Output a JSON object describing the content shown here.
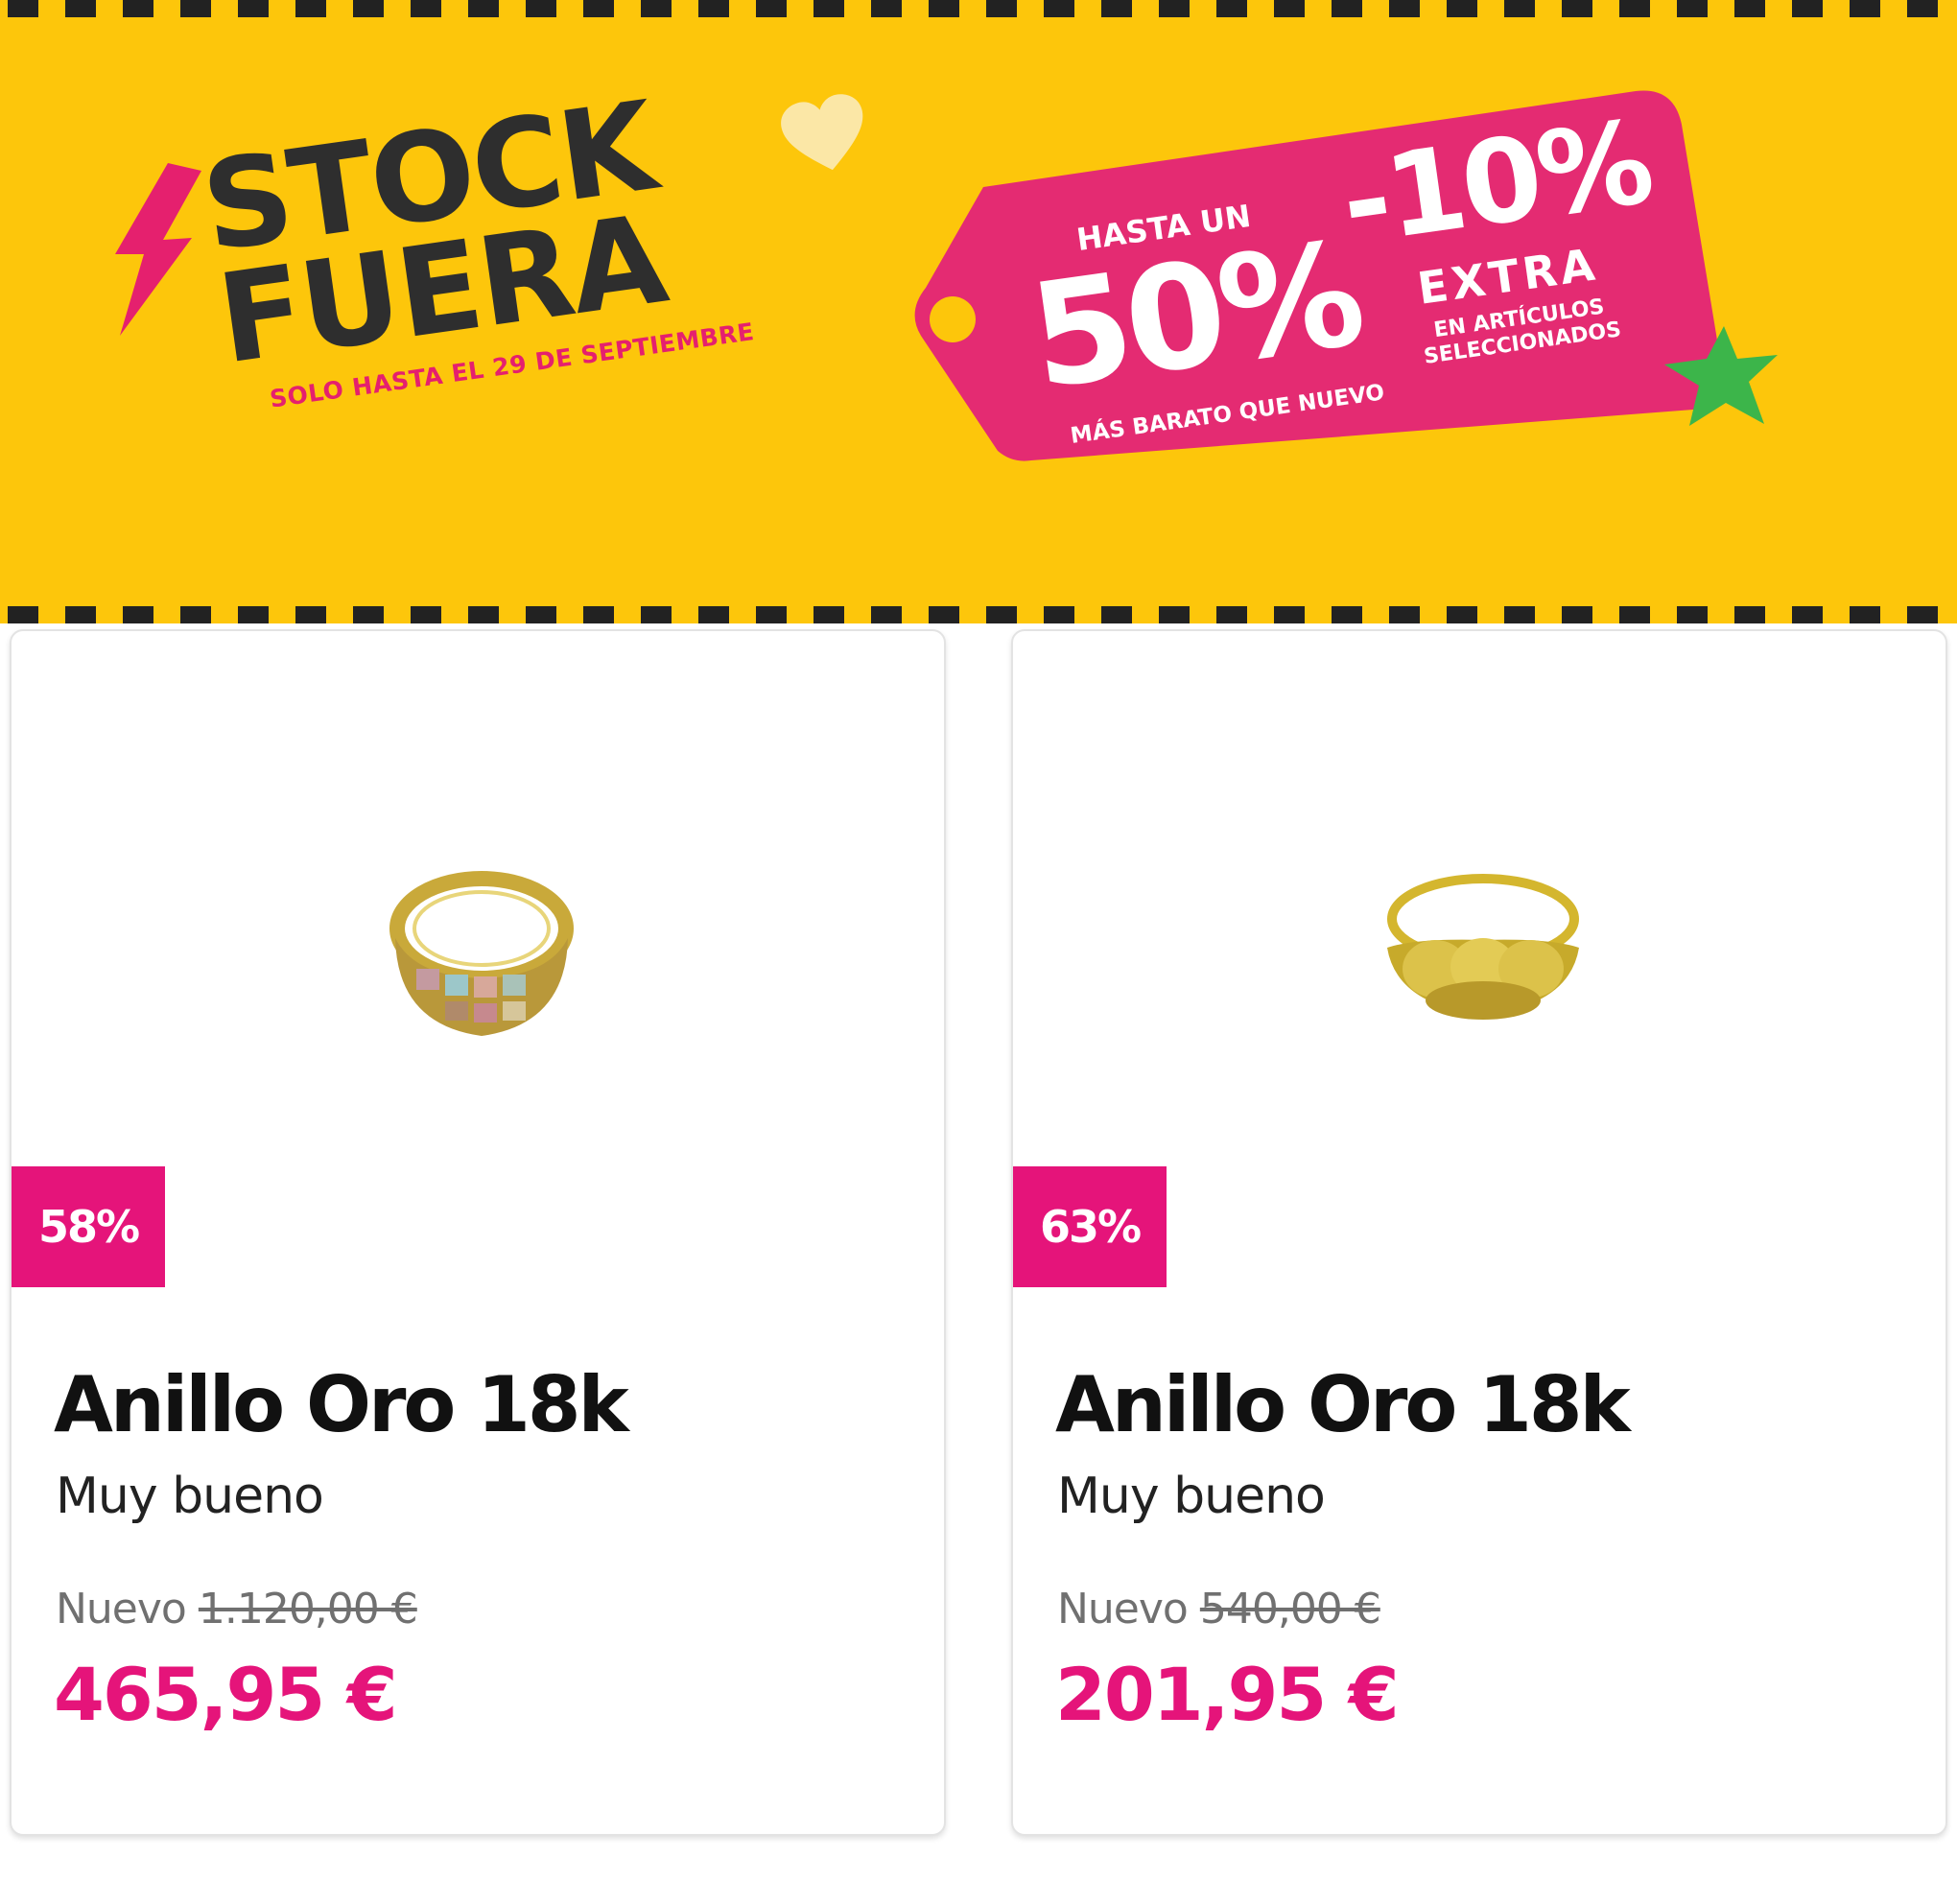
{
  "banner": {
    "brand_line1": "STOCK",
    "brand_line2": "FUERA",
    "date_text": "SOLO HASTA EL 29 DE SEPTIEMBRE",
    "tag": {
      "up_to": "HASTA UN",
      "discount": "50%",
      "cheaper_than_new": "MÁS BARATO QUE NUEVO",
      "extra_discount": "-10%",
      "extra": "EXTRA",
      "selected_line1": "EN ARTÍCULOS",
      "selected_line2": "SELECCIONADOS"
    },
    "colors": {
      "background": "#FDC60B",
      "tag": "#E42B72",
      "accent_pink": "#E5206E",
      "star": "#3CB54A",
      "dark": "#2E2E2E"
    }
  },
  "products": [
    {
      "discount_badge": "58%",
      "title": "Anillo Oro 18k",
      "condition": "Muy bueno",
      "new_label": "Nuevo",
      "new_price": "1.120,00 €",
      "price": "465,95 €",
      "image_icon": "gold-ring-with-gems"
    },
    {
      "discount_badge": "63%",
      "title": "Anillo Oro 18k",
      "condition": "Muy bueno",
      "new_label": "Nuevo",
      "new_price": "540,00 €",
      "price": "201,95 €",
      "image_icon": "gold-ring-braided"
    }
  ]
}
